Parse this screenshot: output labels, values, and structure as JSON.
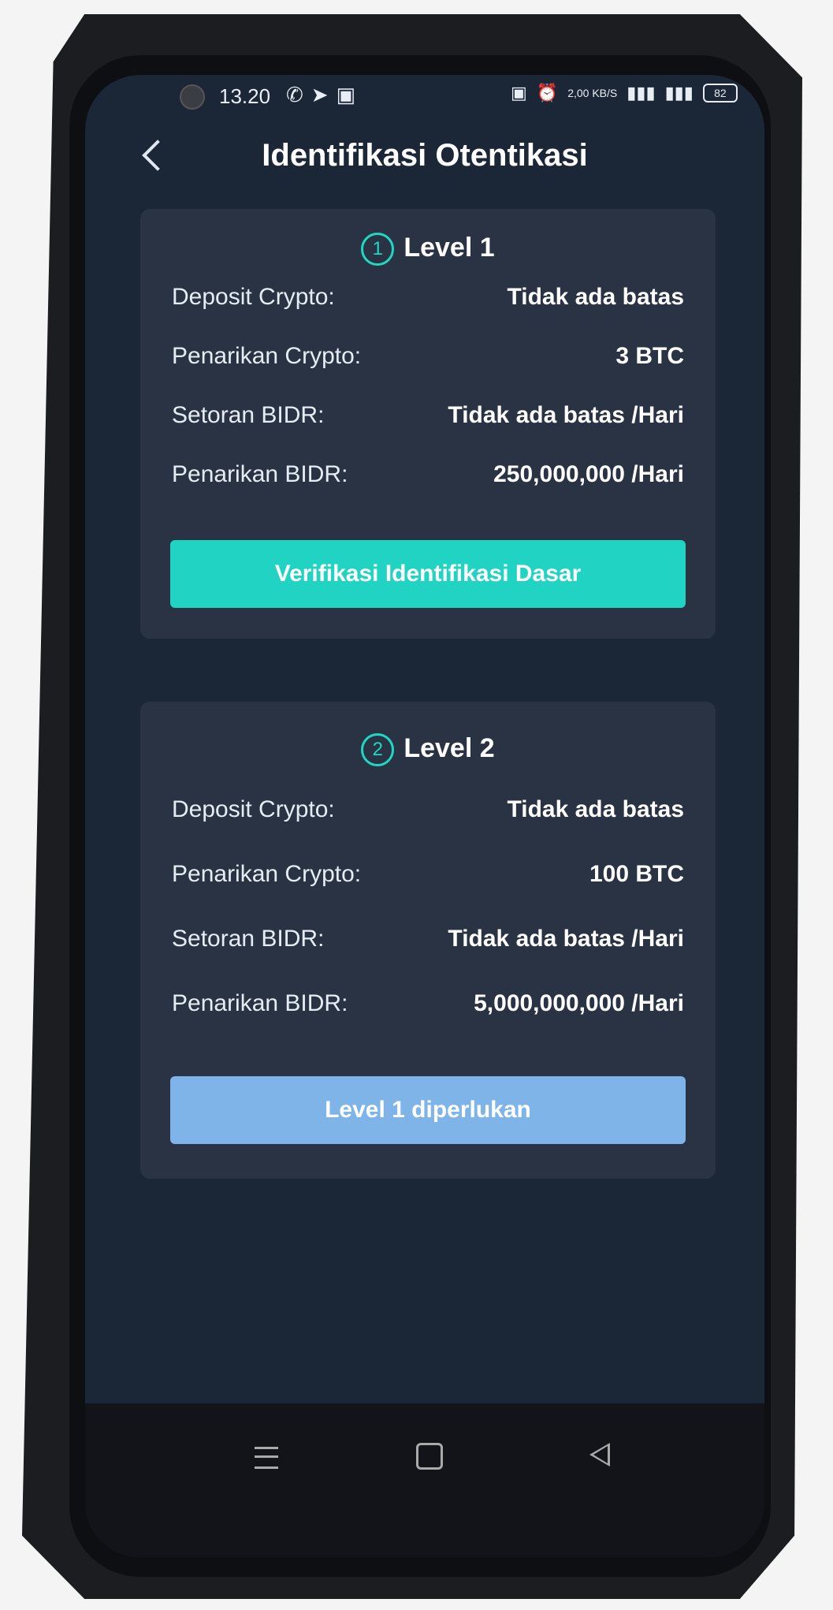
{
  "status": {
    "time": "13.20",
    "left_icons": [
      "whatsapp-icon",
      "telegram-icon",
      "app-icon"
    ],
    "right_text": "2,00 KB/S",
    "battery": "82"
  },
  "header": {
    "title": "Identifikasi Otentikasi"
  },
  "levels": [
    {
      "number": "1",
      "title": "Level 1",
      "rows": [
        {
          "label": "Deposit Crypto:",
          "value": "Tidak ada batas"
        },
        {
          "label": "Penarikan Crypto:",
          "value": "3 BTC"
        },
        {
          "label": "Setoran BIDR:",
          "value": "Tidak ada batas /Hari"
        },
        {
          "label": "Penarikan BIDR:",
          "value": "250,000,000 /Hari"
        }
      ],
      "button": "Verifikasi Identifikasi Dasar"
    },
    {
      "number": "2",
      "title": "Level 2",
      "rows": [
        {
          "label": "Deposit Crypto:",
          "value": "Tidak ada batas"
        },
        {
          "label": "Penarikan Crypto:",
          "value": "100 BTC"
        },
        {
          "label": "Setoran BIDR:",
          "value": "Tidak ada batas /Hari"
        },
        {
          "label": "Penarikan BIDR:",
          "value": "5,000,000,000 /Hari"
        }
      ],
      "button": "Level 1 diperlukan"
    }
  ],
  "colors": {
    "accent": "#21d3c2",
    "disabled_button": "#7fb4e8",
    "background": "#1b2637",
    "card": "#2a3344"
  }
}
